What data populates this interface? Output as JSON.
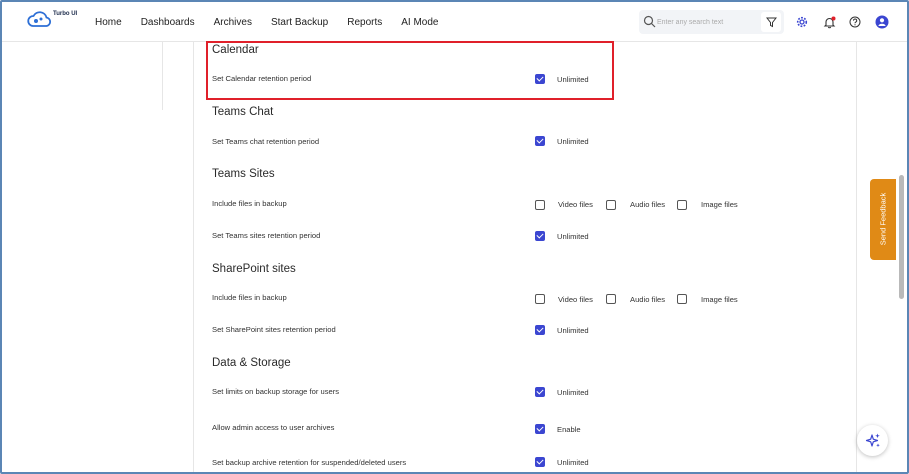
{
  "header": {
    "logo_text": "Turbo UI",
    "nav": [
      "Home",
      "Dashboards",
      "Archives",
      "Start Backup",
      "Reports",
      "AI Mode"
    ],
    "search_placeholder": "Enter any search text"
  },
  "sections": {
    "calendar": {
      "title": "Calendar",
      "retention_label": "Set Calendar retention period",
      "retention_value": "Unlimited"
    },
    "teams_chat": {
      "title": "Teams Chat",
      "retention_label": "Set Teams chat retention period",
      "retention_value": "Unlimited"
    },
    "teams_sites": {
      "title": "Teams Sites",
      "include_label": "Include files in backup",
      "include_options": [
        "Video files",
        "Audio files",
        "Image files"
      ],
      "retention_label": "Set Teams sites retention period",
      "retention_value": "Unlimited"
    },
    "sharepoint": {
      "title": "SharePoint sites",
      "include_label": "Include files in backup",
      "include_options": [
        "Video files",
        "Audio files",
        "Image files"
      ],
      "retention_label": "Set SharePoint sites retention period",
      "retention_value": "Unlimited"
    },
    "data_storage": {
      "title": "Data & Storage",
      "limits_label": "Set limits on backup storage for users",
      "limits_value": "Unlimited",
      "admin_label": "Allow admin access to user archives",
      "admin_value": "Enable",
      "archive_label": "Set backup archive retention for suspended/deleted users",
      "archive_value": "Unlimited"
    }
  },
  "feedback_label": "Send Feedback",
  "colors": {
    "accent": "#3b46d1",
    "highlight": "#e0202a",
    "feedback": "#e08a16"
  }
}
